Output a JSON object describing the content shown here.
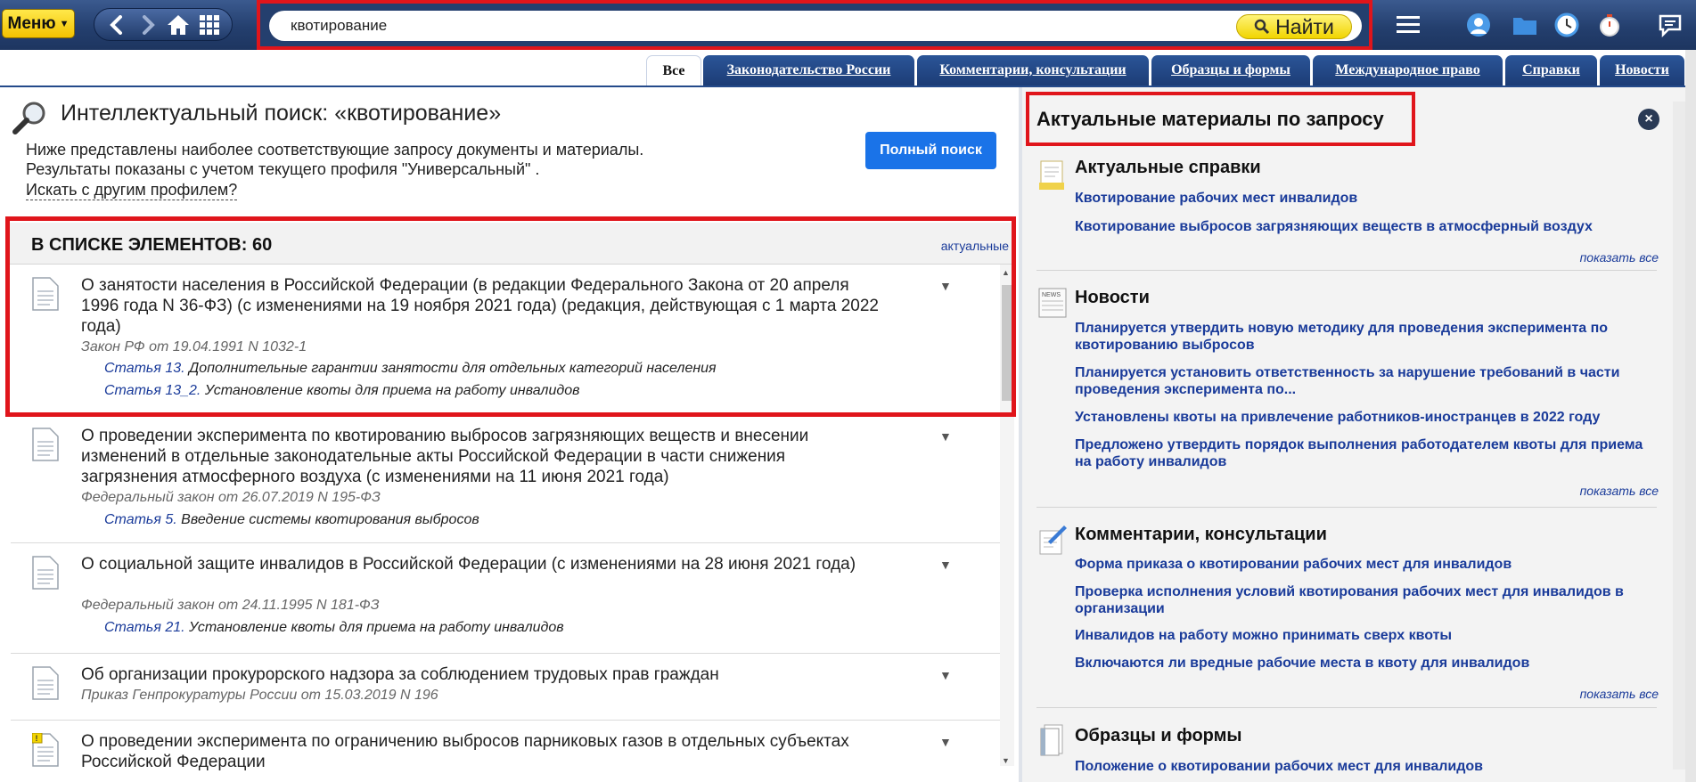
{
  "toolbar": {
    "menu_label": "Меню",
    "search_value": "квотирование",
    "search_button": "Найти"
  },
  "tabs": [
    {
      "label": "Все",
      "active": true
    },
    {
      "label": "Законодательство России"
    },
    {
      "label": "Комментарии, консультации"
    },
    {
      "label": "Образцы и формы"
    },
    {
      "label": "Международное право"
    },
    {
      "label": "Справки"
    },
    {
      "label": "Новости"
    }
  ],
  "intro": {
    "title": "Интеллектуальный поиск: «квотирование»",
    "line1": "Ниже представлены наиболее соответствующие запросу документы и материалы.",
    "line2": "Результаты показаны с учетом текущего профиля \"Универсальный\" .",
    "profile_link": "Искать с другим профилем?",
    "full_search_button": "Полный поиск"
  },
  "list": {
    "count_label": "В СПИСКЕ ЭЛЕМЕНТОВ: 60",
    "filter_label": "актуальные",
    "documents": [
      {
        "title": "О занятости населения в Российской Федерации (в редакции Федерального Закона от 20 апреля 1996 года N 36-ФЗ) (с изменениями на 19 ноября 2021 года) (редакция, действующая с 1 марта 2022 года)",
        "meta": "Закон РФ от 19.04.1991 N 1032-1",
        "articles": [
          {
            "num": "Статья 13.",
            "text": "Дополнительные гарантии занятости для отдельных категорий населения"
          },
          {
            "num": "Статья 13_2.",
            "text": "Установление квоты для приема на работу инвалидов"
          }
        ]
      },
      {
        "title": "О проведении эксперимента по квотированию выбросов загрязняющих веществ и внесении изменений в отдельные законодательные акты Российской Федерации в части снижения загрязнения атмосферного воздуха (с изменениями на 11 июня 2021 года)",
        "meta": "Федеральный закон от 26.07.2019 N 195-ФЗ",
        "articles": [
          {
            "num": "Статья 5.",
            "text": "Введение системы квотирования выбросов"
          }
        ]
      },
      {
        "title": "О социальной защите инвалидов в Российской Федерации (с изменениями на 28 июня 2021 года)",
        "meta": "Федеральный закон от 24.11.1995 N 181-ФЗ",
        "articles": [
          {
            "num": "Статья 21.",
            "text": "Установление квоты для приема на работу инвалидов"
          }
        ]
      },
      {
        "title": "Об организации прокурорского надзора за соблюдением трудовых прав граждан",
        "meta": "Приказ Генпрокуратуры России от 15.03.2019 N 196",
        "articles": []
      },
      {
        "title": "О проведении эксперимента по ограничению выбросов парниковых газов в отдельных субъектах Российской Федерации",
        "meta": "",
        "articles": []
      }
    ]
  },
  "right": {
    "title": "Актуальные материалы по запросу",
    "show_all": "показать все",
    "sections": [
      {
        "title": "Актуальные справки",
        "links": [
          "Квотирование рабочих мест инвалидов",
          "Квотирование выбросов загрязняющих веществ в атмосферный воздух"
        ]
      },
      {
        "title": "Новости",
        "links": [
          "Планируется утвердить новую методику для проведения эксперимента по квотированию выбросов",
          "Планируется установить ответственность за нарушение требований в части проведения эксперимента по...",
          "Установлены квоты на привлечение работников-иностранцев в 2022 году",
          "Предложено утвердить порядок выполнения работодателем квоты для приема на работу инвалидов"
        ]
      },
      {
        "title": "Комментарии, консультации",
        "links": [
          "Форма приказа о квотировании рабочих мест для инвалидов",
          "Проверка исполнения условий квотирования рабочих мест для инвалидов в организации",
          "Инвалидов на работу можно принимать сверх квоты",
          "Включаются ли вредные рабочие места в квоту для инвалидов"
        ]
      },
      {
        "title": "Образцы и формы",
        "links": [
          "Положение о квотировании рабочих мест для инвалидов"
        ]
      }
    ]
  }
}
